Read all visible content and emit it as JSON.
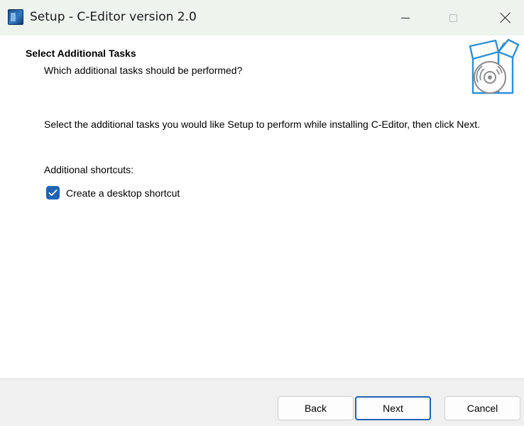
{
  "window": {
    "title": "Setup - C-Editor version 2.0"
  },
  "header": {
    "title": "Select Additional Tasks",
    "subtitle": "Which additional tasks should be performed?"
  },
  "main": {
    "description": "Select the additional tasks you would like Setup to perform while installing C-Editor, then click Next.",
    "shortcuts_label": "Additional shortcuts:",
    "tasks": [
      {
        "label": "Create a desktop shortcut",
        "checked": true
      }
    ]
  },
  "footer": {
    "back_label": "Back",
    "next_label": "Next",
    "cancel_label": "Cancel"
  },
  "colors": {
    "accent": "#1f63b8",
    "titlebar_bg": "#edf4ee",
    "footer_bg": "#f0f0f0",
    "graphic_blue": "#2f8fd6"
  },
  "icons": {
    "app": "setup-app-icon",
    "graphic": "box-with-disc-icon",
    "checkbox": "checkmark-icon"
  }
}
